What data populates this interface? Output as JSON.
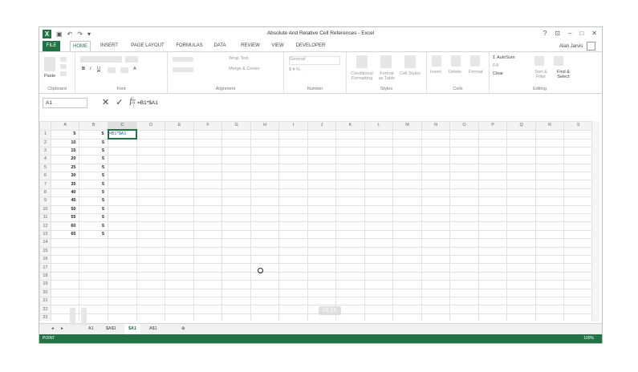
{
  "window": {
    "title": "Absolute And Relative Cell References - Excel",
    "user": "Alan Jarvis",
    "controls": [
      "?",
      "⊡",
      "–",
      "□",
      "✕"
    ]
  },
  "ribbon_tabs": [
    "FILE",
    "HOME",
    "INSERT",
    "PAGE LAYOUT",
    "FORMULAS",
    "DATA",
    "REVIEW",
    "VIEW",
    "DEVELOPER"
  ],
  "ribbon": {
    "clipboard": {
      "paste": "Paste",
      "label": "Clipboard"
    },
    "font": {
      "label": "Font"
    },
    "alignment": {
      "wrap": "Wrap Text",
      "merge": "Merge & Center",
      "label": "Alignment"
    },
    "number": {
      "format": "General",
      "label": "Number"
    },
    "styles": {
      "conditional": "Conditional Formatting",
      "format_table": "Format as Table",
      "cell_styles": "Cell Styles",
      "label": "Styles"
    },
    "cells": {
      "insert": "Insert",
      "delete": "Delete",
      "format": "Format",
      "label": "Cells"
    },
    "editing": {
      "autosum": "AutoSum",
      "fill": "Fill",
      "clear": "Clear",
      "sort": "Sort & Filter",
      "find": "Find & Select",
      "label": "Editing"
    }
  },
  "formula_bar": {
    "name_box": "A1",
    "formula": "=B1*$A1"
  },
  "columns": [
    "A",
    "B",
    "C",
    "D",
    "E",
    "F",
    "G",
    "H",
    "I",
    "J",
    "K",
    "L",
    "M",
    "N",
    "O",
    "P",
    "Q",
    "R",
    "S"
  ],
  "rows": [
    {
      "n": "1",
      "a": "5",
      "b": "5",
      "c": "=B1*$A1"
    },
    {
      "n": "2",
      "a": "10",
      "b": "5",
      "c": ""
    },
    {
      "n": "3",
      "a": "15",
      "b": "5",
      "c": ""
    },
    {
      "n": "4",
      "a": "20",
      "b": "5",
      "c": ""
    },
    {
      "n": "5",
      "a": "25",
      "b": "5",
      "c": ""
    },
    {
      "n": "6",
      "a": "30",
      "b": "5",
      "c": ""
    },
    {
      "n": "7",
      "a": "35",
      "b": "5",
      "c": ""
    },
    {
      "n": "8",
      "a": "40",
      "b": "5",
      "c": ""
    },
    {
      "n": "9",
      "a": "45",
      "b": "5",
      "c": ""
    },
    {
      "n": "10",
      "a": "50",
      "b": "5",
      "c": ""
    },
    {
      "n": "11",
      "a": "55",
      "b": "5",
      "c": ""
    },
    {
      "n": "12",
      "a": "60",
      "b": "5",
      "c": ""
    },
    {
      "n": "13",
      "a": "65",
      "b": "5",
      "c": ""
    },
    {
      "n": "14"
    },
    {
      "n": "15"
    },
    {
      "n": "16"
    },
    {
      "n": "17"
    },
    {
      "n": "18"
    },
    {
      "n": "19"
    },
    {
      "n": "20"
    },
    {
      "n": "21"
    },
    {
      "n": "22"
    },
    {
      "n": "23"
    }
  ],
  "sheet_tabs": [
    "A1",
    "$A$1",
    "$A1",
    "A$1"
  ],
  "active_sheet": "$A1",
  "status": {
    "mode": "POINT",
    "zoom": "100%"
  },
  "video": {
    "time": "01:15"
  },
  "colors": {
    "accent": "#217346"
  }
}
